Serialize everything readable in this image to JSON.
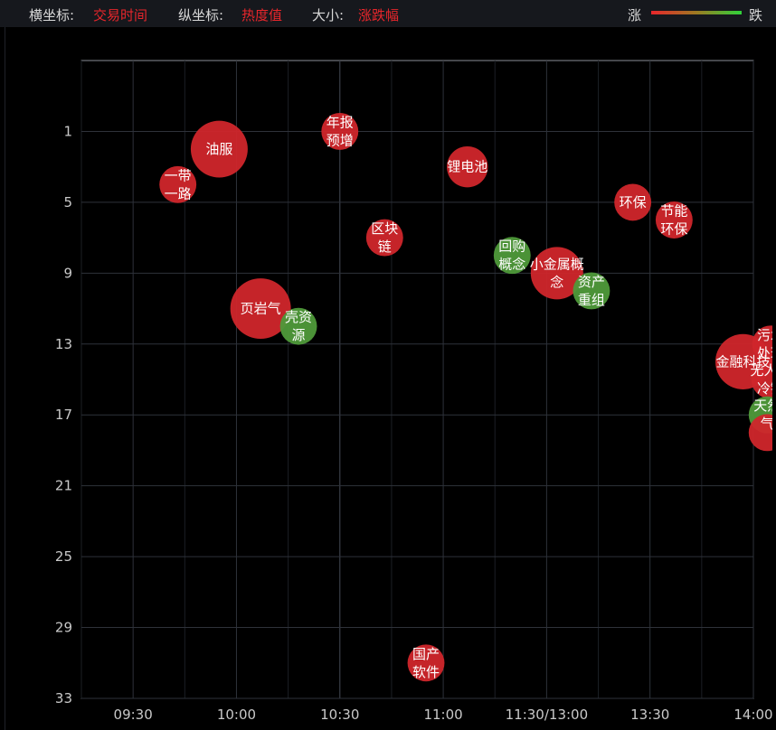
{
  "header": {
    "x_key": "横坐标:",
    "x_val": "交易时间",
    "y_key": "纵坐标:",
    "y_val": "热度值",
    "size_key": "大小:",
    "size_val": "涨跌幅",
    "legend_up": "涨",
    "legend_down": "跌"
  },
  "colors": {
    "up": "#d0262b",
    "down": "#4f9a3a",
    "grid": "#2e323a",
    "axis": "#8a8e96"
  },
  "chart_data": {
    "type": "scatter",
    "title": "",
    "xlabel": "交易时间",
    "ylabel": "热度值",
    "size_by": "涨跌幅",
    "x_ticks": [
      "09:30",
      "10:00",
      "10:30",
      "11:00",
      "11:30/13:00",
      "13:30",
      "14:00"
    ],
    "y_ticks": [
      1,
      5,
      9,
      13,
      17,
      21,
      25,
      29,
      33
    ],
    "y_range": [
      33,
      -3
    ],
    "y_inverted": true,
    "x_range_minutes_of_session": [
      -15,
      180
    ],
    "points": [
      {
        "label": "一带\n一路",
        "x": "09:43",
        "y": 4,
        "size": 1.8,
        "trend": "up"
      },
      {
        "label": "油服",
        "x": "09:55",
        "y": 2,
        "size": 4.8,
        "trend": "up"
      },
      {
        "label": "页岩气",
        "x": "10:07",
        "y": 11,
        "size": 5.5,
        "trend": "up"
      },
      {
        "label": "壳资\n源",
        "x": "10:18",
        "y": 12,
        "size": 1.8,
        "trend": "down"
      },
      {
        "label": "年报\n预增",
        "x": "10:30",
        "y": 1,
        "size": 1.8,
        "trend": "up"
      },
      {
        "label": "区块\n链",
        "x": "10:43",
        "y": 7,
        "size": 1.8,
        "trend": "up"
      },
      {
        "label": "国产\n软件",
        "x": "10:55",
        "y": 31,
        "size": 1.8,
        "trend": "up"
      },
      {
        "label": "锂电池",
        "x": "11:07",
        "y": 3,
        "size": 2.3,
        "trend": "up"
      },
      {
        "label": "回购\n概念",
        "x": "11:20",
        "y": 8,
        "size": 1.8,
        "trend": "down"
      },
      {
        "label": "小金属概\n念",
        "x": "13:03",
        "y": 9,
        "size": 4.0,
        "trend": "up"
      },
      {
        "label": "资产\n重组",
        "x": "13:13",
        "y": 10,
        "size": 1.8,
        "trend": "down"
      },
      {
        "label": "环保",
        "x": "13:25",
        "y": 5,
        "size": 1.8,
        "trend": "up"
      },
      {
        "label": "节能\n环保",
        "x": "13:37",
        "y": 6,
        "size": 1.8,
        "trend": "up"
      },
      {
        "label": "金融科技",
        "x": "13:57",
        "y": 14,
        "size": 4.5,
        "trend": "up"
      },
      {
        "label": "污水\n处理",
        "x": "14:05",
        "y": 13,
        "size": 1.8,
        "trend": "up"
      },
      {
        "label": "无人机\n冷链",
        "x": "14:05",
        "y": 15,
        "size": 2.0,
        "trend": "up"
      },
      {
        "label": "天然\n气",
        "x": "14:04",
        "y": 17,
        "size": 1.8,
        "trend": "down"
      },
      {
        "label": "",
        "x": "14:04",
        "y": 18,
        "size": 1.8,
        "trend": "up"
      }
    ]
  }
}
